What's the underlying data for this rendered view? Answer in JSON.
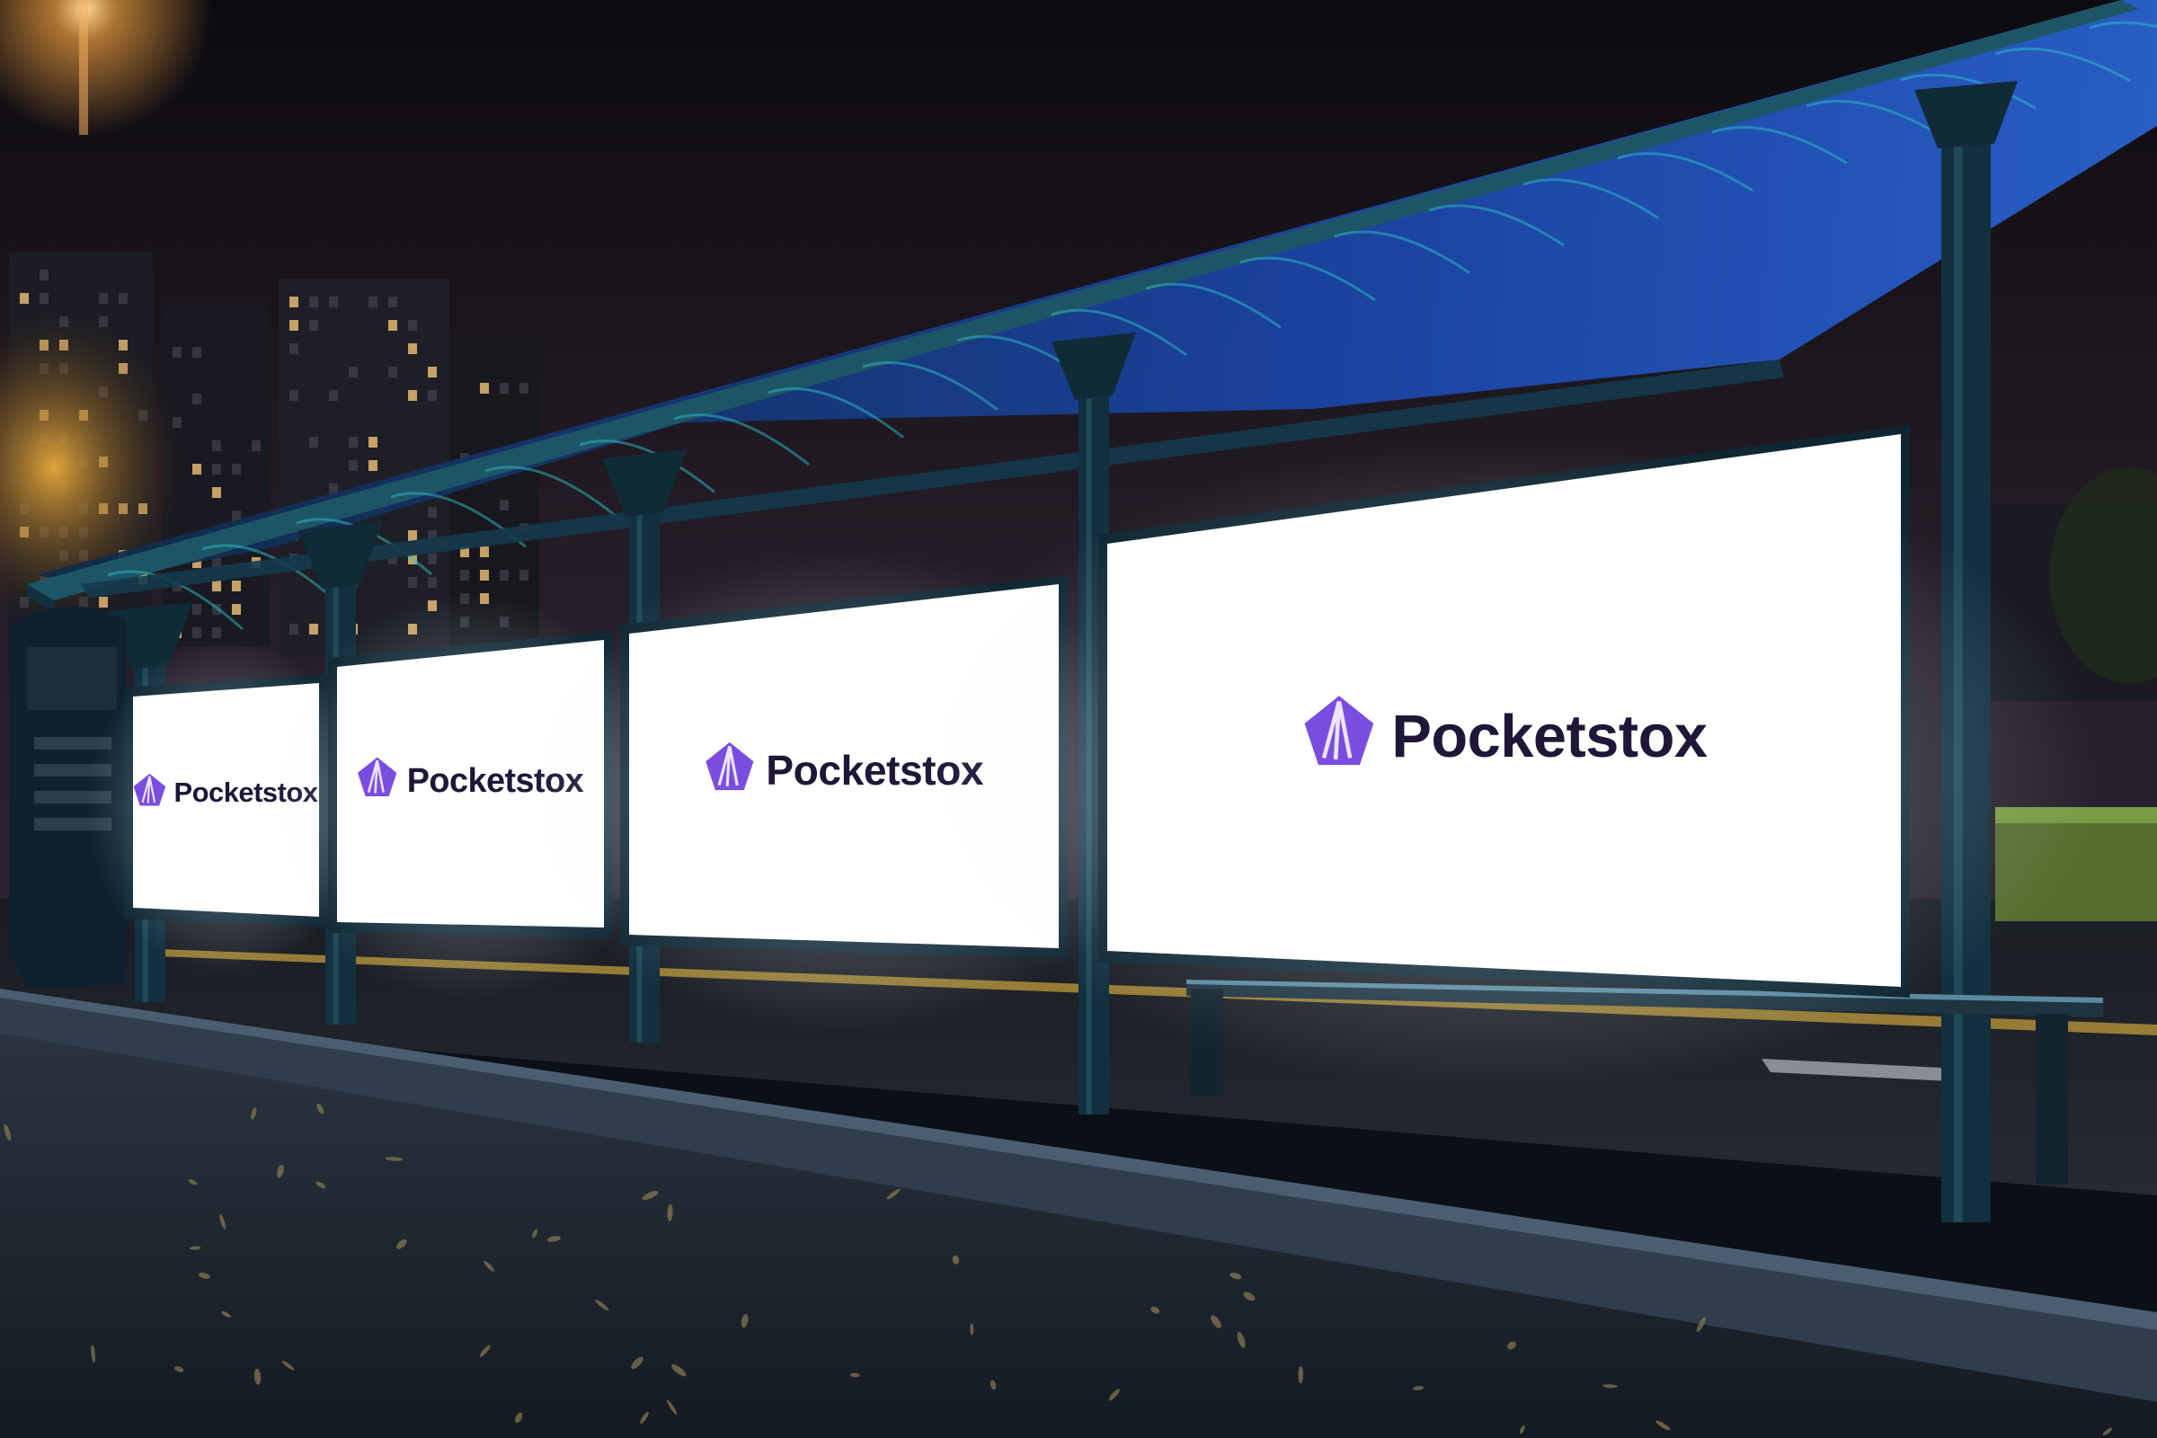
{
  "scene": {
    "subject": "bus-shelter-billboard-mockup",
    "time_of_day": "night"
  },
  "brand": {
    "name": "Pocketstox",
    "logo_icon": "pocketstox-fan-icon",
    "logo_color": "#7a4de0",
    "text_color": "#1f1638"
  },
  "billboards": [
    {
      "label": "Pocketstox"
    },
    {
      "label": "Pocketstox"
    },
    {
      "label": "Pocketstox"
    },
    {
      "label": "Pocketstox"
    }
  ],
  "palette": {
    "sky_top": "#0e0c10",
    "sky_bottom": "#2a2230",
    "shelter_frame": "#163848",
    "roof_glass": "#1d4fb8",
    "screen": "#ffffff",
    "pavement": "#1c2530",
    "street_light": "#f0a040",
    "hedge": "#6b8a38"
  }
}
